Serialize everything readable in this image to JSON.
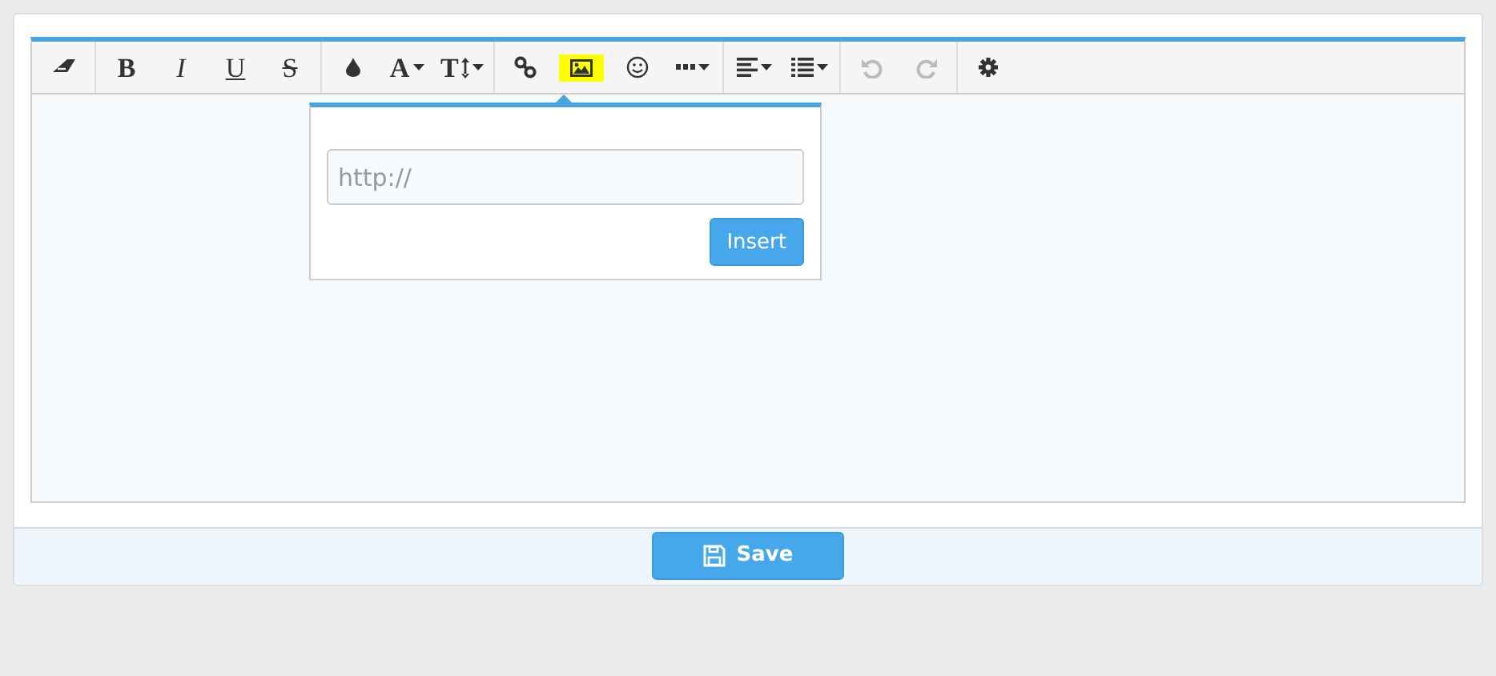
{
  "toolbar": {
    "groups": [
      [
        {
          "kind": "eraser",
          "selected": false,
          "disabled": false,
          "dropdown": false
        }
      ],
      [
        {
          "kind": "bold",
          "label": "B",
          "selected": false,
          "disabled": false,
          "dropdown": false
        },
        {
          "kind": "italic",
          "label": "I",
          "selected": false,
          "disabled": false,
          "dropdown": false
        },
        {
          "kind": "underline",
          "label": "U",
          "selected": false,
          "disabled": false,
          "dropdown": false
        },
        {
          "kind": "strike",
          "label": "S",
          "selected": false,
          "disabled": false,
          "dropdown": false
        }
      ],
      [
        {
          "kind": "droplet",
          "selected": false,
          "disabled": false,
          "dropdown": false
        },
        {
          "kind": "font",
          "label": "A",
          "selected": false,
          "disabled": false,
          "dropdown": true
        },
        {
          "kind": "size",
          "label": "T",
          "selected": false,
          "disabled": false,
          "dropdown": true
        }
      ],
      [
        {
          "kind": "link",
          "selected": false,
          "disabled": false,
          "dropdown": false
        },
        {
          "kind": "image",
          "selected": true,
          "disabled": false,
          "dropdown": false
        },
        {
          "kind": "smiley",
          "selected": false,
          "disabled": false,
          "dropdown": false
        },
        {
          "kind": "dots",
          "selected": false,
          "disabled": false,
          "dropdown": true
        }
      ],
      [
        {
          "kind": "align",
          "selected": false,
          "disabled": false,
          "dropdown": true
        },
        {
          "kind": "list",
          "selected": false,
          "disabled": false,
          "dropdown": true
        }
      ],
      [
        {
          "kind": "undo",
          "selected": false,
          "disabled": true,
          "dropdown": false
        },
        {
          "kind": "redo",
          "selected": false,
          "disabled": true,
          "dropdown": false
        }
      ],
      [
        {
          "kind": "gear",
          "selected": false,
          "disabled": false,
          "dropdown": false
        }
      ]
    ]
  },
  "popover": {
    "placeholder": "http://",
    "button": "Insert"
  },
  "save_button": "Save"
}
